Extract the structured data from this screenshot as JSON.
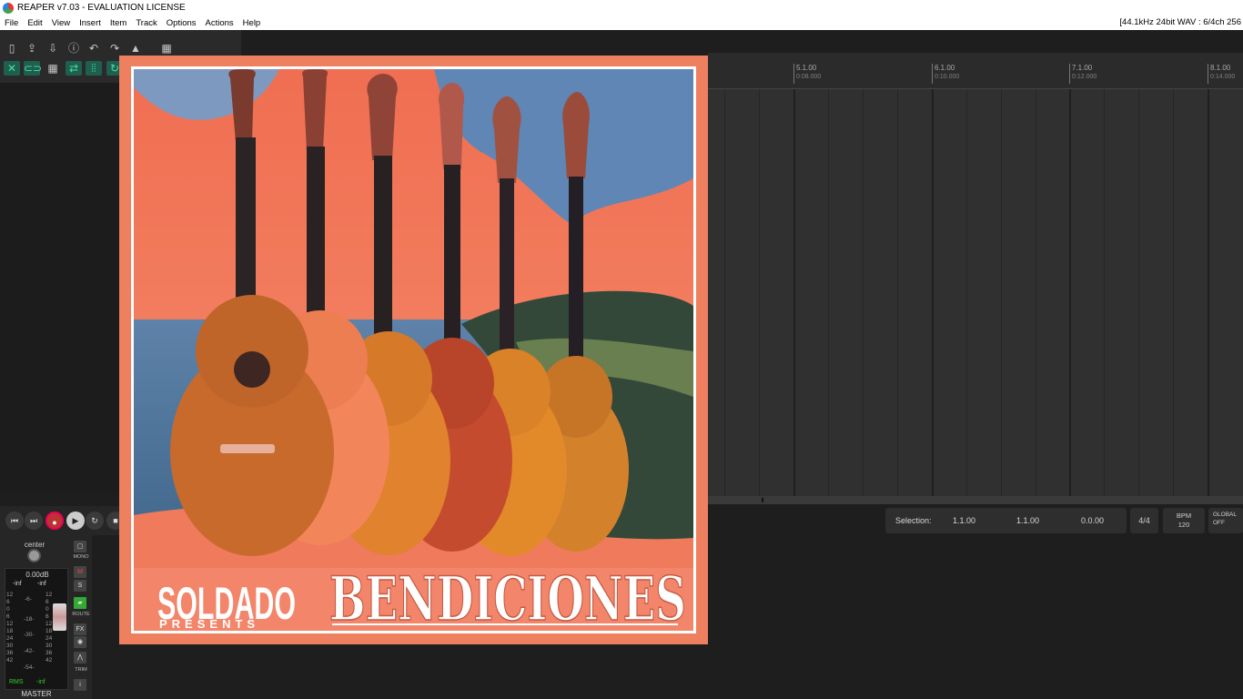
{
  "window": {
    "title": "REAPER v7.03 - EVALUATION LICENSE",
    "audio_status": "[44.1kHz 24bit WAV : 6/4ch 256"
  },
  "menu": [
    "File",
    "Edit",
    "View",
    "Insert",
    "Item",
    "Track",
    "Options",
    "Actions",
    "Help"
  ],
  "ruler": [
    {
      "bar": "5.1.00",
      "time": "0:08.000"
    },
    {
      "bar": "6.1.00",
      "time": "0:10.000"
    },
    {
      "bar": "7.1.00",
      "time": "0:12.000"
    },
    {
      "bar": "8.1.00",
      "time": "0:14.000"
    }
  ],
  "selection": {
    "label": "Selection:",
    "start": "1.1.00",
    "end": "1.1.00",
    "length": "0.0.00"
  },
  "time_signature": "4/4",
  "bpm": {
    "label": "BPM",
    "value": "120"
  },
  "global": {
    "label": "GLOBAL",
    "state": "OFF"
  },
  "master": {
    "pan": "center",
    "volume": "0.00dB",
    "peak_left": "-inf",
    "peak_right": "-inf",
    "scale_left": [
      "12",
      "6",
      "0",
      "6",
      "12",
      "18",
      "24",
      "30",
      "36",
      "42"
    ],
    "scale_mid": [
      "-6-",
      "-18-",
      "-30-",
      "-42-",
      "-54-"
    ],
    "scale_right": [
      "12",
      "6",
      "0",
      "6",
      "12",
      "18",
      "24",
      "30",
      "36",
      "42"
    ],
    "rms_label": "RMS",
    "rms_value": "-inf",
    "label": "MASTER",
    "buttons": {
      "mono": "MONO",
      "mute": "M",
      "solo": "S",
      "route": "ROUTE",
      "fx": "FX",
      "trim": "TRIM",
      "info": "i"
    }
  },
  "album": {
    "artist": "SOLDADO",
    "presents": "PRESENTS",
    "title": "BENDICIONES"
  },
  "colors": {
    "album_bg": "#ee7f5f",
    "reaper_green": "#46e0a0",
    "record": "#b33333"
  }
}
